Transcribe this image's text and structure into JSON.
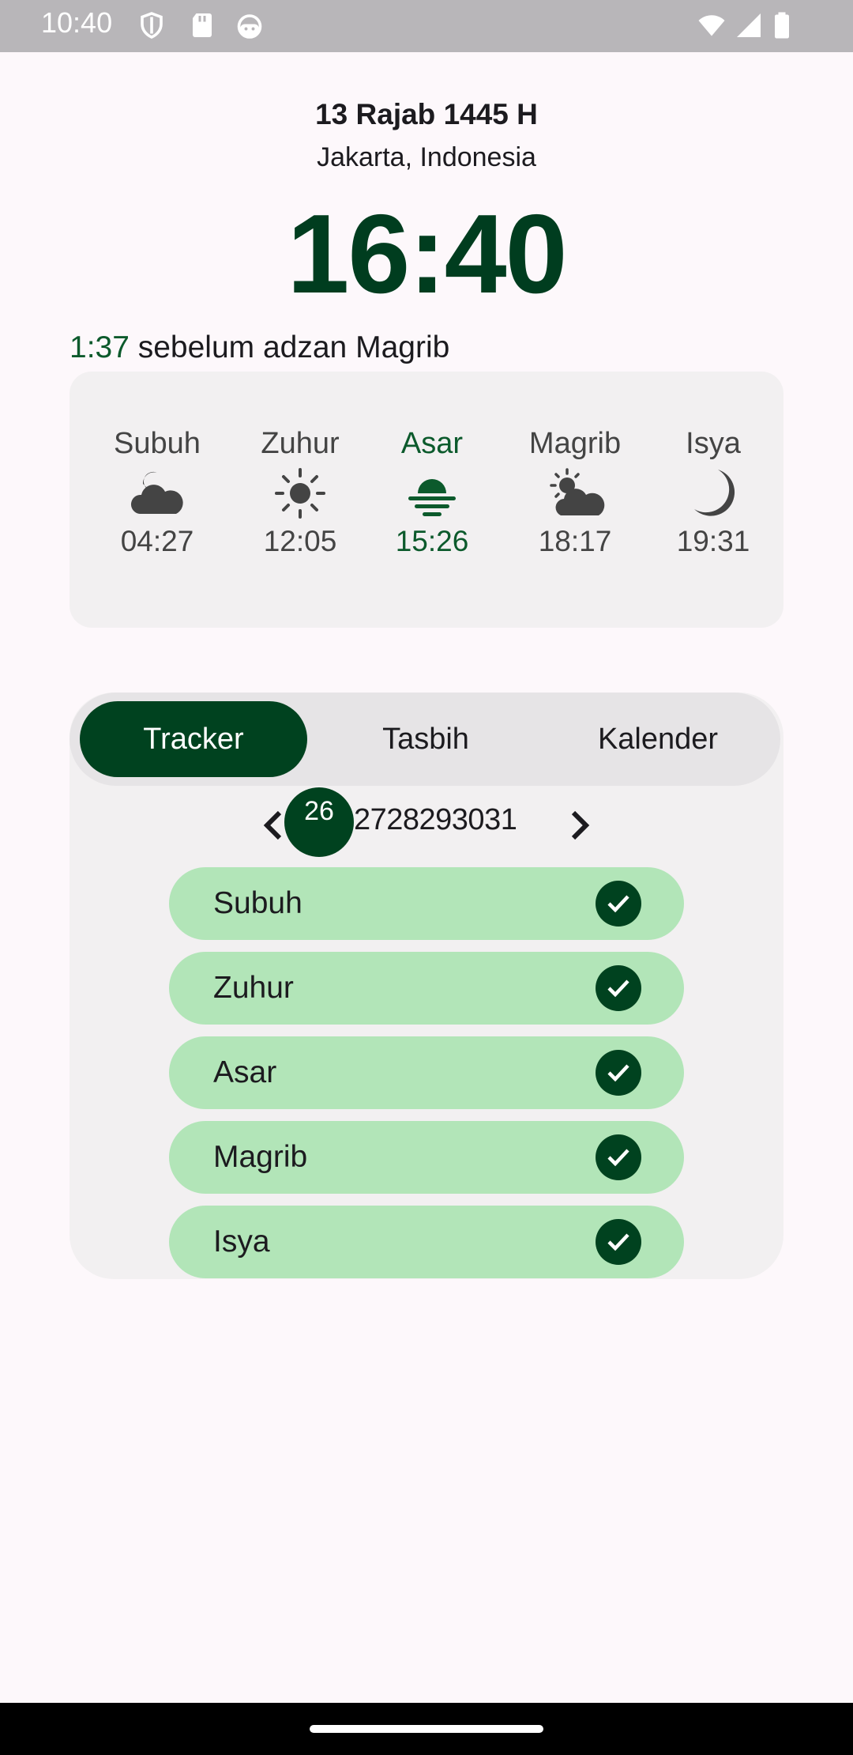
{
  "status_bar": {
    "time": "10:40",
    "left_icons": [
      "shield-icon",
      "sd-card-icon",
      "android-face-icon"
    ],
    "right_icons": [
      "wifi-icon",
      "signal-icon",
      "battery-icon"
    ]
  },
  "header": {
    "hijri_date": "13 Rajab 1445 H",
    "location": "Jakarta, Indonesia",
    "clock": "16:40",
    "countdown_time": "1:37",
    "countdown_text": " sebelum adzan Magrib"
  },
  "prayer_times": [
    {
      "name": "Subuh",
      "time": "04:27",
      "icon": "cloud-moon-icon",
      "active": false
    },
    {
      "name": "Zuhur",
      "time": "12:05",
      "icon": "sun-icon",
      "active": false
    },
    {
      "name": "Asar",
      "time": "15:26",
      "icon": "sunset-icon",
      "active": true
    },
    {
      "name": "Magrib",
      "time": "18:17",
      "icon": "sun-cloud-icon",
      "active": false
    },
    {
      "name": "Isya",
      "time": "19:31",
      "icon": "crescent-moon-icon",
      "active": false
    }
  ],
  "tabs": [
    {
      "label": "Tracker",
      "active": true
    },
    {
      "label": "Tasbih",
      "active": false
    },
    {
      "label": "Kalender",
      "active": false
    }
  ],
  "date_pager": {
    "selected_day": "26",
    "other_days": "2728293031"
  },
  "tracker": [
    {
      "label": "Subuh",
      "checked": true
    },
    {
      "label": "Zuhur",
      "checked": true
    },
    {
      "label": "Asar",
      "checked": true
    },
    {
      "label": "Magrib",
      "checked": true
    },
    {
      "label": "Isya",
      "checked": true
    }
  ],
  "colors": {
    "primary": "#00421f",
    "accent_text": "#0c5a2c",
    "tracker_item_bg": "#b2e5b8",
    "card_bg": "#f2f0f1"
  }
}
